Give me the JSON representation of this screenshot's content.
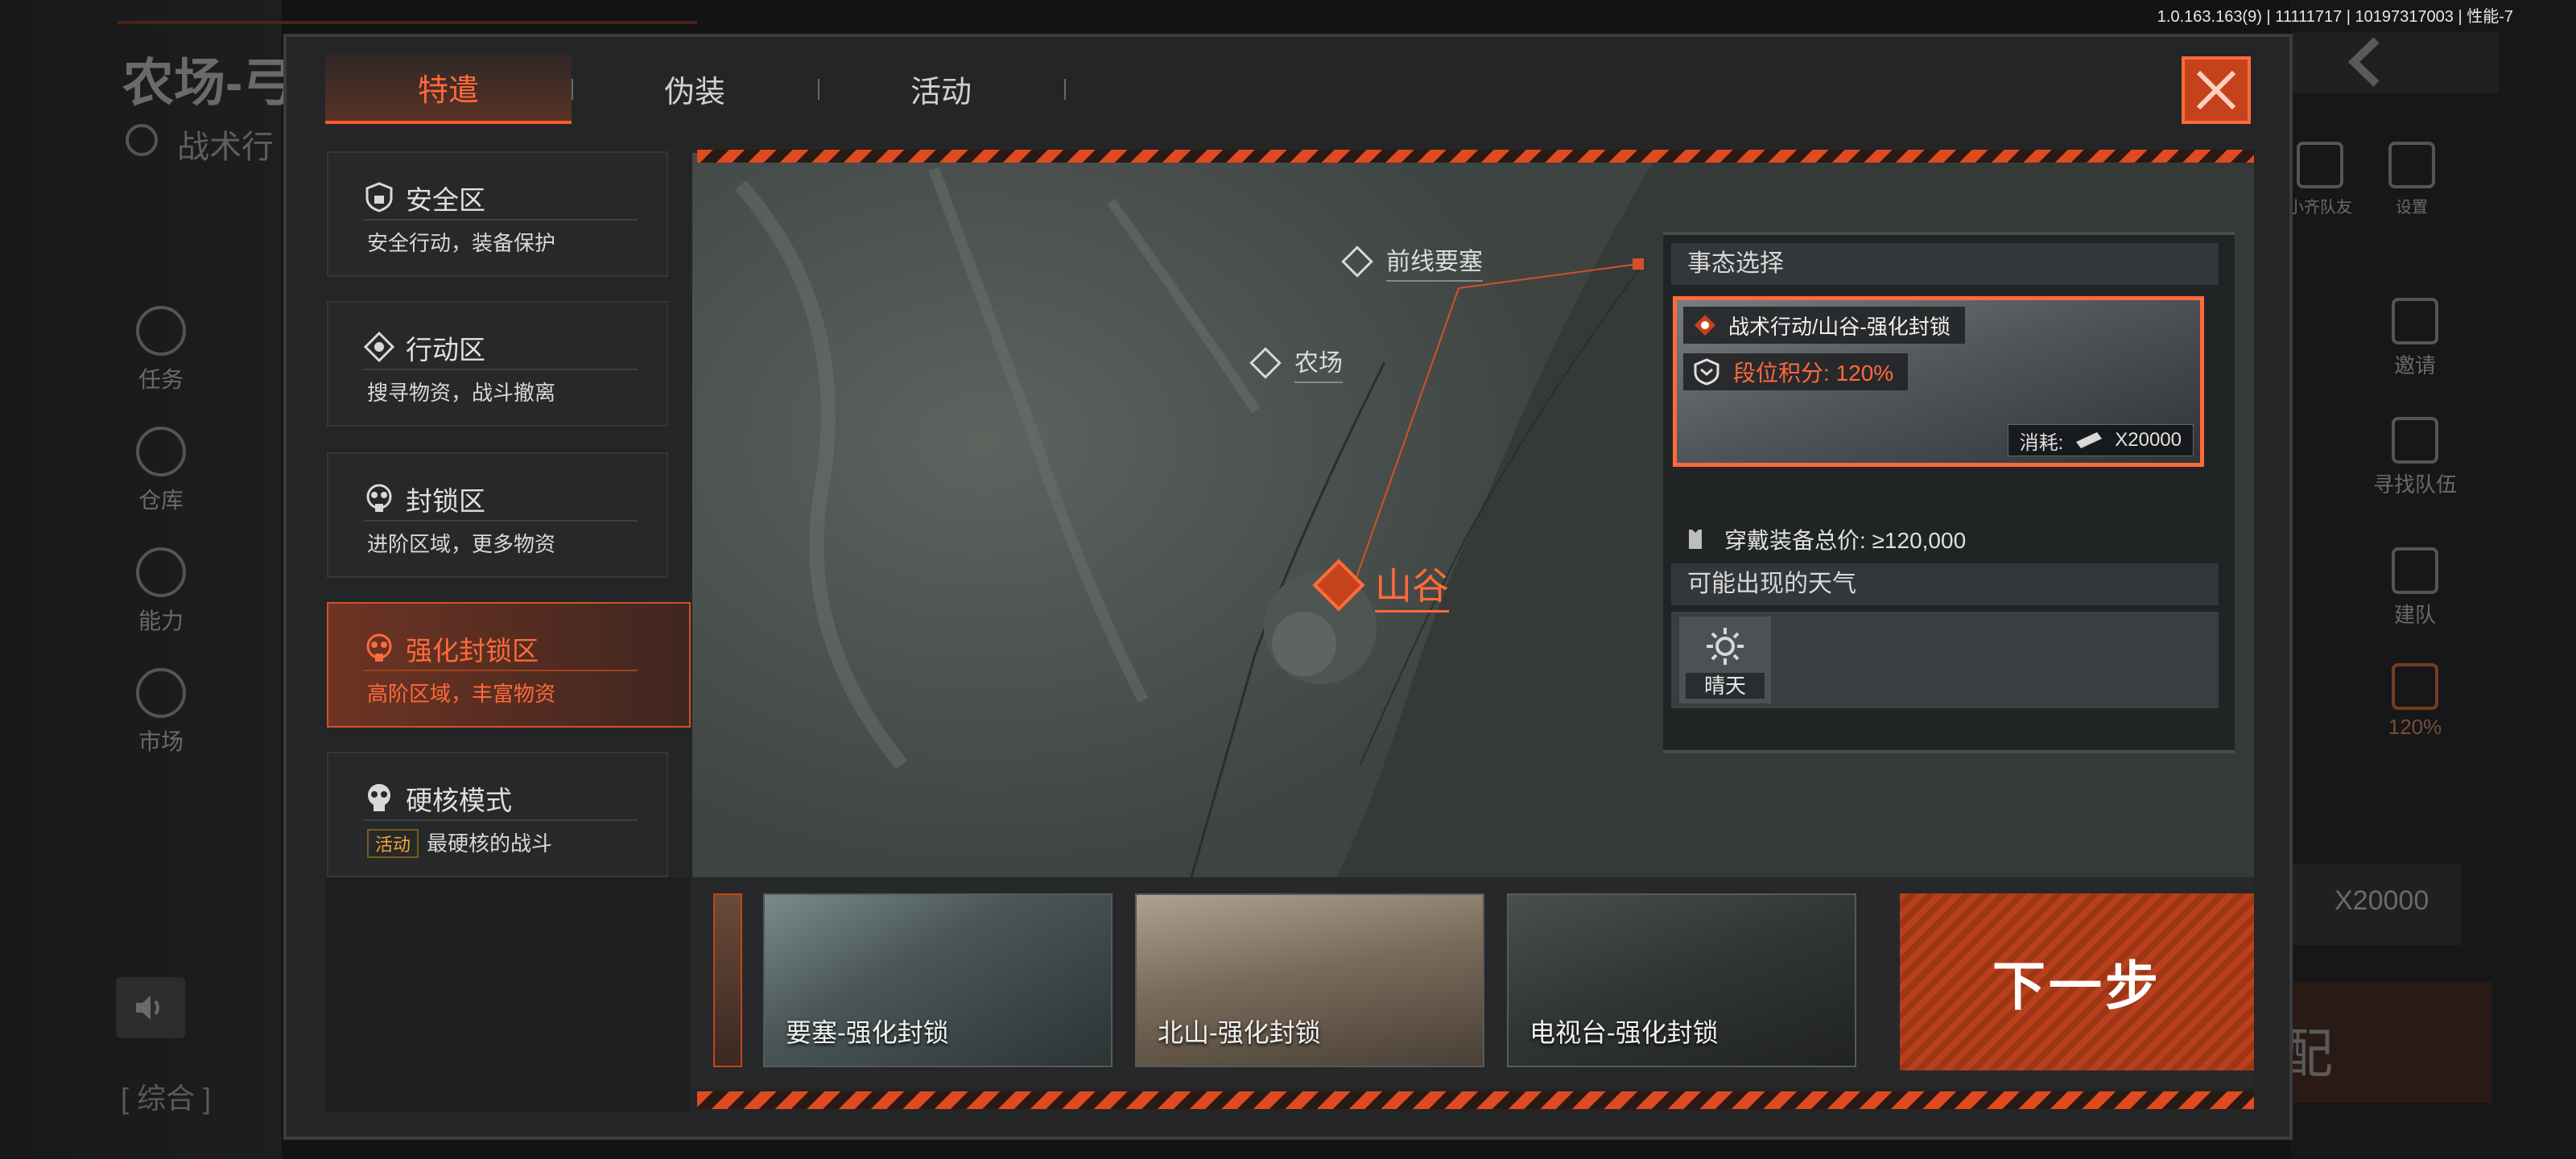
{
  "version": "1.0.163.163(9) | 11111717 | 10197317003 | 性能-7",
  "background": {
    "title": "农场-弓",
    "subtitle": "战术行",
    "left_nav": [
      {
        "label": "任务",
        "icon": "task-icon"
      },
      {
        "label": "仓库",
        "icon": "warehouse-icon"
      },
      {
        "label": "能力",
        "icon": "ability-icon"
      },
      {
        "label": "市场",
        "icon": "market-icon"
      }
    ],
    "right_nav": [
      {
        "label": "小齐队友",
        "icon": "teammates-icon"
      },
      {
        "label": "设置",
        "icon": "settings-icon"
      },
      {
        "label": "邀请",
        "icon": "invite-icon"
      },
      {
        "label": "寻找队伍",
        "icon": "find-team-icon"
      },
      {
        "label": "建队",
        "icon": "create-team-icon"
      },
      {
        "label": "120%",
        "icon": "rank-icon"
      }
    ],
    "cost_right": "X20000",
    "bottom_left_label": "[ 综合 ]",
    "bottom_right_text": "配"
  },
  "tabs": [
    {
      "label": "特遣",
      "active": true
    },
    {
      "label": "伪装",
      "active": false
    },
    {
      "label": "活动",
      "active": false
    }
  ],
  "zones": [
    {
      "name": "安全区",
      "desc": "安全行动，装备保护",
      "icon": "shield-icon"
    },
    {
      "name": "行动区",
      "desc": "搜寻物资，战斗撤离",
      "icon": "action-icon"
    },
    {
      "name": "封锁区",
      "desc": "进阶区域，更多物资",
      "icon": "gasmask-icon"
    },
    {
      "name": "强化封锁区",
      "desc": "高阶区域，丰富物资",
      "icon": "gasmask-icon",
      "active": true
    },
    {
      "name": "硬核模式",
      "tag": "活动",
      "desc": "最硬核的战斗",
      "icon": "skull-icon"
    }
  ],
  "map": {
    "locations": [
      {
        "name": "前线要塞"
      },
      {
        "name": "农场"
      }
    ],
    "selected_location": "山谷"
  },
  "info": {
    "event_header": "事态选择",
    "event_name": "战术行动/山谷-强化封锁",
    "score_bonus": "段位积分: 120%",
    "cost_label": "消耗:",
    "cost_value": "X20000",
    "gear_label": "穿戴装备总价: ≥120,000",
    "weather_header": "可能出现的天气",
    "weather": [
      {
        "label": "晴天",
        "icon": "sun-icon"
      }
    ]
  },
  "map_cards": [
    {
      "title": "要塞-强化封锁"
    },
    {
      "title": "北山-强化封锁"
    },
    {
      "title": "电视台-强化封锁"
    }
  ],
  "next_button": "下一步",
  "colors": {
    "accent": "#ff6a3a",
    "accent_dark": "#c4431c",
    "panel": "#232526"
  }
}
